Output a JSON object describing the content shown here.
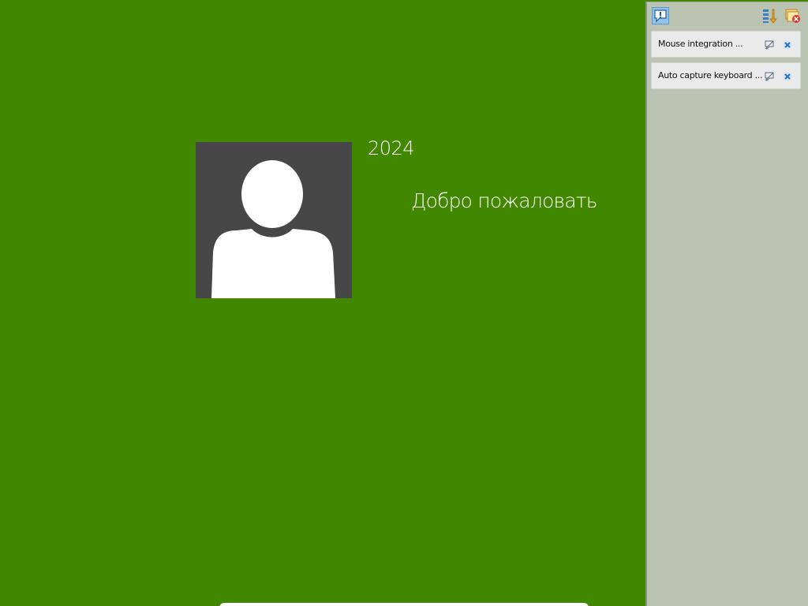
{
  "login": {
    "user_name": "2024",
    "welcome": "Добро пожаловать"
  },
  "notification_panel": {
    "toolbar": {
      "notify_icon": "notification-center-icon",
      "sort_icon": "sort-icon",
      "close_all_icon": "close-all-icon"
    },
    "items": [
      {
        "text": "Mouse integration ...",
        "dont_show_icon": "dont-show-again-icon",
        "close_icon": "close-icon"
      },
      {
        "text": "Auto capture keyboard ...",
        "dont_show_icon": "dont-show-again-icon",
        "close_icon": "close-icon"
      }
    ]
  },
  "colors": {
    "background": "#418700",
    "avatar_bg": "#474747",
    "panel_bg": "#bbc3b3",
    "item_bg": "#eaeaea"
  }
}
